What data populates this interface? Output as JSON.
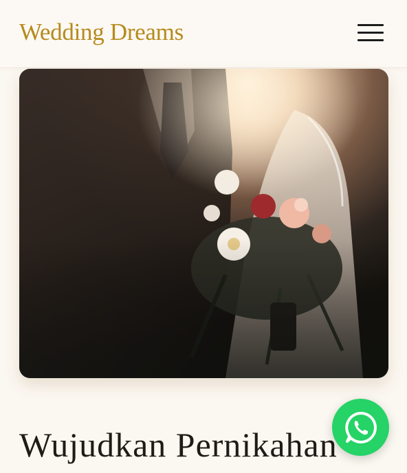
{
  "header": {
    "brand": "Wedding Dreams",
    "menu_icon": "hamburger-menu-icon"
  },
  "hero": {
    "image_subject": "wedding couple with bridal bouquet"
  },
  "main": {
    "headline": "Wujudkan Pernikahan"
  },
  "floating": {
    "whatsapp_icon": "whatsapp-icon",
    "color": "#25d366"
  },
  "colors": {
    "brand": "#b68a1d",
    "background": "#fbf7f1",
    "headline": "#1f1b17"
  }
}
